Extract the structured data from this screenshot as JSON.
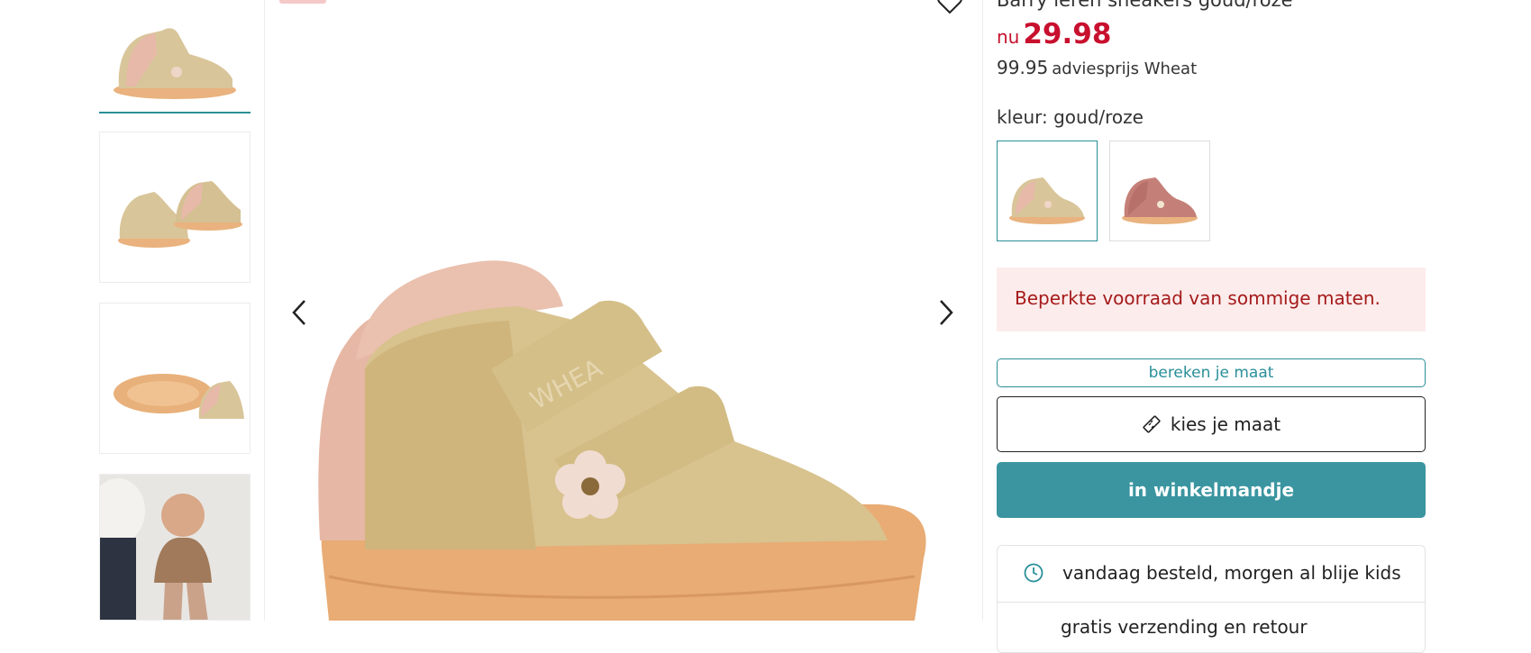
{
  "product": {
    "title": "Barry leren sneakers goud/roze",
    "price_prefix": "nu",
    "price_now": "29.98",
    "price_old": "99.95",
    "price_advice_label": "adviesprijs Wheat",
    "color_label": "kleur: goud/roze"
  },
  "gallery": {
    "thumbnails": [
      "gold-pink sneaker side",
      "pair of gold sneakers",
      "sneakers sole view",
      "child wearing sneakers"
    ],
    "prev_icon": "chevron-left-icon",
    "next_icon": "chevron-right-icon",
    "favorite_icon": "heart-icon"
  },
  "swatches": [
    "goud/roze",
    "roze"
  ],
  "alert": {
    "text": "Beperkte voorraad van sommige maten."
  },
  "actions": {
    "calc_size_label": "bereken je maat",
    "choose_size_label": "kies je maat",
    "add_to_cart_label": "in winkelmandje"
  },
  "usps": {
    "delivery": "vandaag besteld, morgen al blije kids",
    "second": "gratis verzending en retour"
  },
  "colors": {
    "accent": "#3a95a0",
    "price_red": "#c8102e",
    "alert_bg": "#fdecec",
    "alert_text": "#a51a1a"
  }
}
